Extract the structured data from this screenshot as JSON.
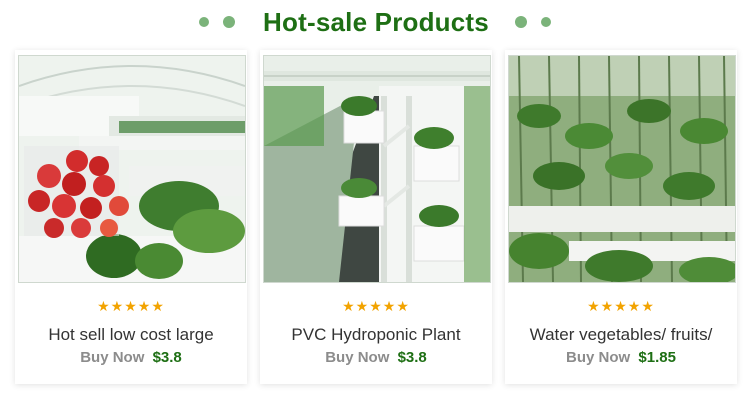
{
  "header": {
    "title": "Hot-sale Products"
  },
  "products": [
    {
      "name": "Hot sell low cost large",
      "stars": "★★★★★",
      "buy_label": "Buy Now",
      "price": "$3.8",
      "image": "strawberry-greenhouse-photo"
    },
    {
      "name": "PVC Hydroponic Plant",
      "stars": "★★★★★",
      "buy_label": "Buy Now",
      "price": "$3.8",
      "image": "hydroponic-rack-photo"
    },
    {
      "name": "Water vegetables/ fruits/",
      "stars": "★★★★★",
      "buy_label": "Buy Now",
      "price": "$1.85",
      "image": "vine-greenhouse-photo"
    }
  ],
  "colors": {
    "title": "#1e6f14",
    "price": "#1e6f14",
    "stars": "#f2a300",
    "buy": "#8c8c8c",
    "dots": "#7bb37a"
  }
}
